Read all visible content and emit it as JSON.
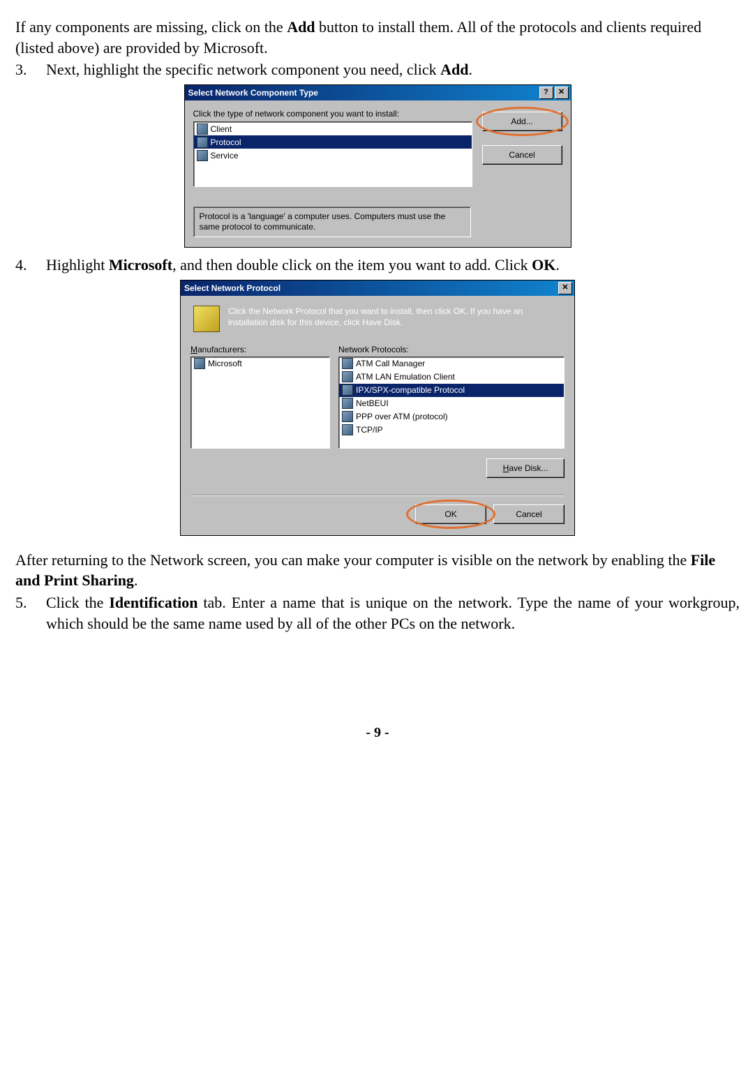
{
  "intro1": "If any components are missing, click on the ",
  "intro_add": "Add",
  "intro2": " button to install them. All of the protocols and clients required (listed above) are provided by Microsoft.",
  "step3_num": "3.",
  "step3_a": "Next, highlight the specific network component you need, click ",
  "step3_b": "Add",
  "step3_c": ".",
  "dlg1": {
    "title": "Select Network Component Type",
    "help": "?",
    "close": "✕",
    "prompt": "Click the type of network component you want to install:",
    "items": [
      "Client",
      "Protocol",
      "Service"
    ],
    "add": "Add...",
    "cancel": "Cancel",
    "desc": "Protocol is a 'language' a computer uses. Computers must use the same protocol to communicate."
  },
  "step4_num": "4.",
  "step4_a": "Highlight ",
  "step4_b": "Microsoft",
  "step4_c": ", and then double click on the item you want to add. Click ",
  "step4_d": "OK",
  "step4_e": ".",
  "dlg2": {
    "title": "Select Network Protocol",
    "close": "✕",
    "msg": "Click the Network Protocol that you want to install, then click OK. If you have an installation disk for this device, click Have Disk.",
    "manufacturers_label_a": "M",
    "manufacturers_label_b": "anufacturers:",
    "protocols_label": "Network Protocols:",
    "manufacturers": [
      "Microsoft"
    ],
    "protocols": [
      "ATM Call Manager",
      "ATM LAN Emulation Client",
      "IPX/SPX-compatible Protocol",
      "NetBEUI",
      "PPP over ATM (protocol)",
      "TCP/IP"
    ],
    "have_disk_a": "H",
    "have_disk_b": "ave Disk...",
    "ok": "OK",
    "cancel": "Cancel"
  },
  "after_a": "After returning to the Network screen, you can make your computer is visible on the network by enabling the ",
  "after_b": "File and Print Sharing",
  "after_c": ".",
  "step5_num": "5.",
  "step5_a": "Click the ",
  "step5_b": "Identification",
  "step5_c": " tab. Enter a name that is unique on the network.   Type the name of your workgroup, which should be the same name used by all of the other PCs on the network.",
  "page": "- 9 -"
}
